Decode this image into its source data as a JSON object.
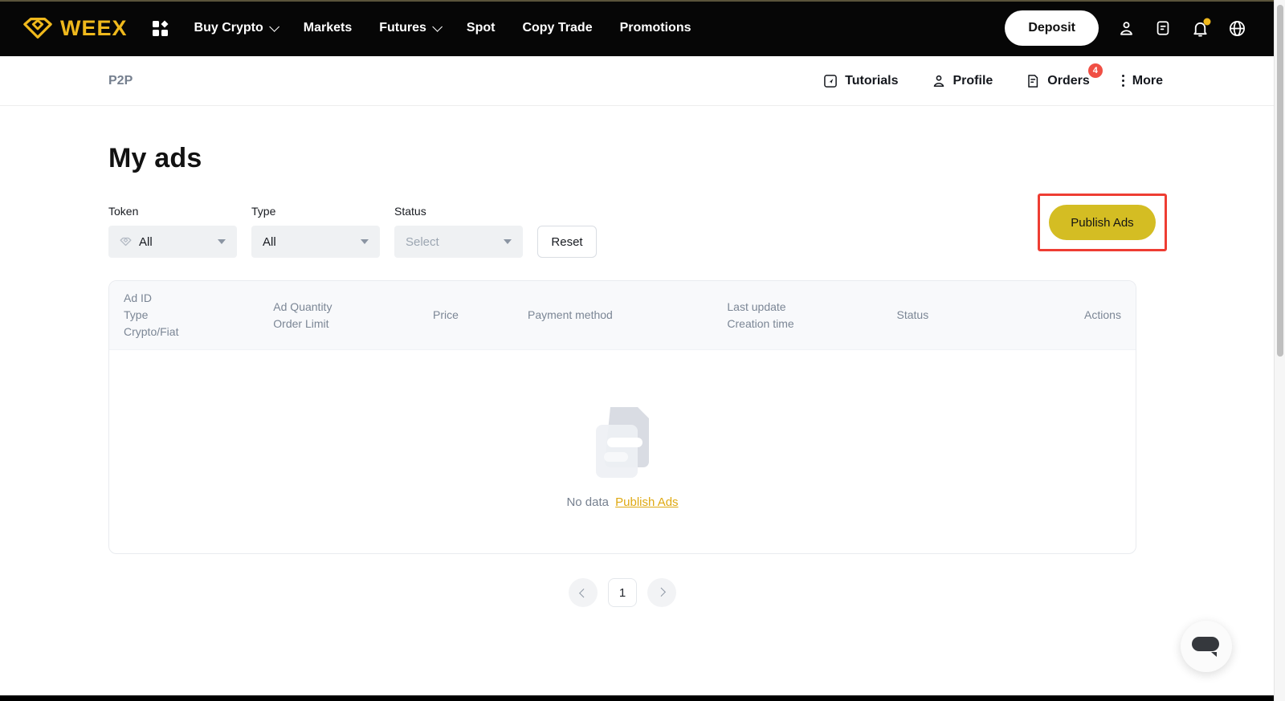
{
  "topbar": {
    "brand": "WEEX",
    "menu": [
      {
        "label": "Buy Crypto"
      },
      {
        "label": "Markets"
      },
      {
        "label": "Futures"
      },
      {
        "label": "Spot"
      },
      {
        "label": "Copy Trade"
      },
      {
        "label": "Promotions"
      }
    ],
    "deposit_label": "Deposit"
  },
  "subheader": {
    "title": "P2P",
    "tutorials_label": "Tutorials",
    "profile_label": "Profile",
    "orders_label": "Orders",
    "orders_badge": "4",
    "more_label": "More"
  },
  "page": {
    "heading": "My ads",
    "filters": {
      "token_label": "Token",
      "token_value": "All",
      "type_label": "Type",
      "type_value": "All",
      "status_label": "Status",
      "status_placeholder": "Select",
      "reset_label": "Reset"
    },
    "publish_button_label": "Publish Ads"
  },
  "table": {
    "columns": [
      {
        "lines": [
          "Ad ID",
          "Type",
          "Crypto/Fiat"
        ]
      },
      {
        "lines": [
          "Ad Quantity",
          "Order Limit"
        ]
      },
      {
        "lines": [
          "Price"
        ]
      },
      {
        "lines": [
          "Payment method"
        ]
      },
      {
        "lines": [
          "Last update",
          "Creation time"
        ]
      },
      {
        "lines": [
          "Status"
        ]
      },
      {
        "lines": [
          "Actions"
        ]
      }
    ],
    "empty_text": "No data",
    "empty_link": "Publish Ads"
  },
  "pagination": {
    "page": "1"
  },
  "colors": {
    "brand_yellow": "#efb81c",
    "button_yellow": "#d4bd23",
    "annotation_red": "#ee3d33",
    "badge_red": "#f04f44",
    "link_gold": "#dfa912",
    "muted_text": "#76808f"
  }
}
